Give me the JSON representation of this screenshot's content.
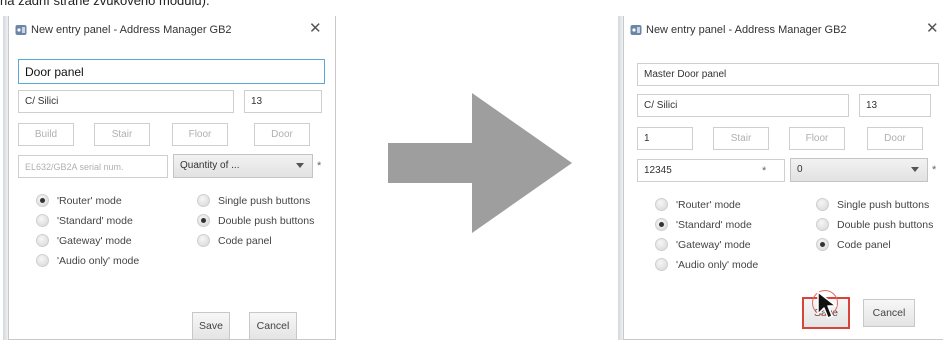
{
  "caption": "na zadní straně zvukového modulu).",
  "left_dialog": {
    "title": "New entry panel - Address Manager GB2",
    "close_icon": "close-icon",
    "fields": {
      "name": "Door panel",
      "street": "C/ Silici",
      "number": "13",
      "build_placeholder": "Build",
      "stair_placeholder": "Stair",
      "floor_placeholder": "Floor",
      "door_placeholder": "Door",
      "serial_placeholder": "EL632/GB2A serial num.",
      "quantity_select": "Quantity of ...",
      "required_mark": "*"
    },
    "modes": [
      {
        "label": "'Router' mode",
        "checked": true
      },
      {
        "label": "'Standard' mode",
        "checked": false
      },
      {
        "label": "'Gateway' mode",
        "checked": false
      },
      {
        "label": "'Audio only' mode",
        "checked": false
      }
    ],
    "button_types": [
      {
        "label": "Single push buttons",
        "checked": false
      },
      {
        "label": "Double push buttons",
        "checked": true
      },
      {
        "label": "Code panel",
        "checked": false
      }
    ],
    "save_label": "Save",
    "cancel_label": "Cancel"
  },
  "right_dialog": {
    "title": "New entry panel - Address Manager GB2",
    "close_icon": "close-icon",
    "fields": {
      "name": "Master Door panel",
      "street": "C/ Silici",
      "number": "13",
      "build_value": "1",
      "stair_placeholder": "Stair",
      "floor_placeholder": "Floor",
      "door_placeholder": "Door",
      "serial_value": "12345",
      "serial_mark": "*",
      "quantity_select": "0",
      "required_mark": "*"
    },
    "modes": [
      {
        "label": "'Router' mode",
        "checked": false
      },
      {
        "label": "'Standard' mode",
        "checked": true
      },
      {
        "label": "'Gateway' mode",
        "checked": false
      },
      {
        "label": "'Audio only' mode",
        "checked": false
      }
    ],
    "button_types": [
      {
        "label": "Single push buttons",
        "checked": false
      },
      {
        "label": "Double push buttons",
        "checked": false
      },
      {
        "label": "Code panel",
        "checked": true
      }
    ],
    "save_label": "Save",
    "cancel_label": "Cancel"
  },
  "colors": {
    "arrow": "#9e9e9e",
    "focus_border": "#5aa8d8",
    "save_highlight": "#d9443a"
  },
  "icons": {
    "transition_arrow": "right-arrow-icon",
    "cursor": "mouse-pointer-icon",
    "app": "app-icon"
  }
}
